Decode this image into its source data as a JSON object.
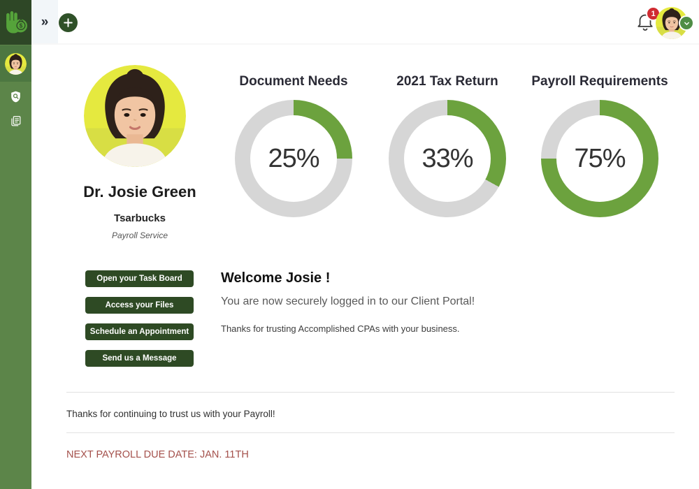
{
  "theme": {
    "sidebar_green": "#5C8549",
    "sidebar_dark_green": "#2E4726",
    "sidebar_avatar_cell": "#4D7741",
    "button_green": "#2E4A24",
    "logo_green": "#55A33A",
    "donut_filled": "#6CA23E",
    "donut_empty": "#D6D6D6",
    "badge_red": "#D02B31",
    "due_date_red": "#A4504B"
  },
  "sidebar": {
    "logo_icon": "hand-ok-money-bag-logo",
    "items": [
      {
        "icon": "user-avatar"
      },
      {
        "icon": "shield-search-icon"
      },
      {
        "icon": "documents-icon"
      }
    ]
  },
  "topbar": {
    "expand_glyph": "»",
    "add_icon": "plus-icon",
    "notification_count": "1",
    "user_menu_icon": "chevron-down-icon"
  },
  "profile": {
    "name": "Dr. Josie Green",
    "company": "Tsarbucks",
    "service": "Payroll Service",
    "actions": [
      "Open your Task Board",
      "Access your Files",
      "Schedule an Appointment",
      "Send us a Message"
    ]
  },
  "chart_data": [
    {
      "type": "pie",
      "title": "Document Needs",
      "value": 25,
      "label": "25%",
      "filled_color": "#6CA23E",
      "empty_color": "#D6D6D6"
    },
    {
      "type": "pie",
      "title": "2021 Tax Return",
      "value": 33,
      "label": "33%",
      "filled_color": "#6CA23E",
      "empty_color": "#D6D6D6"
    },
    {
      "type": "pie",
      "title": "Payroll Requirements",
      "value": 75,
      "label": "75%",
      "filled_color": "#6CA23E",
      "empty_color": "#D6D6D6"
    }
  ],
  "welcome": {
    "heading": "Welcome Josie !",
    "line1": "You are now securely logged in to our Client Portal!",
    "line2": "Thanks for trusting Accomplished CPAs with your business."
  },
  "footer": {
    "payroll_note": "Thanks for continuing to trust us with your Payroll!",
    "due_date": "NEXT PAYROLL DUE DATE: JAN. 11TH"
  }
}
